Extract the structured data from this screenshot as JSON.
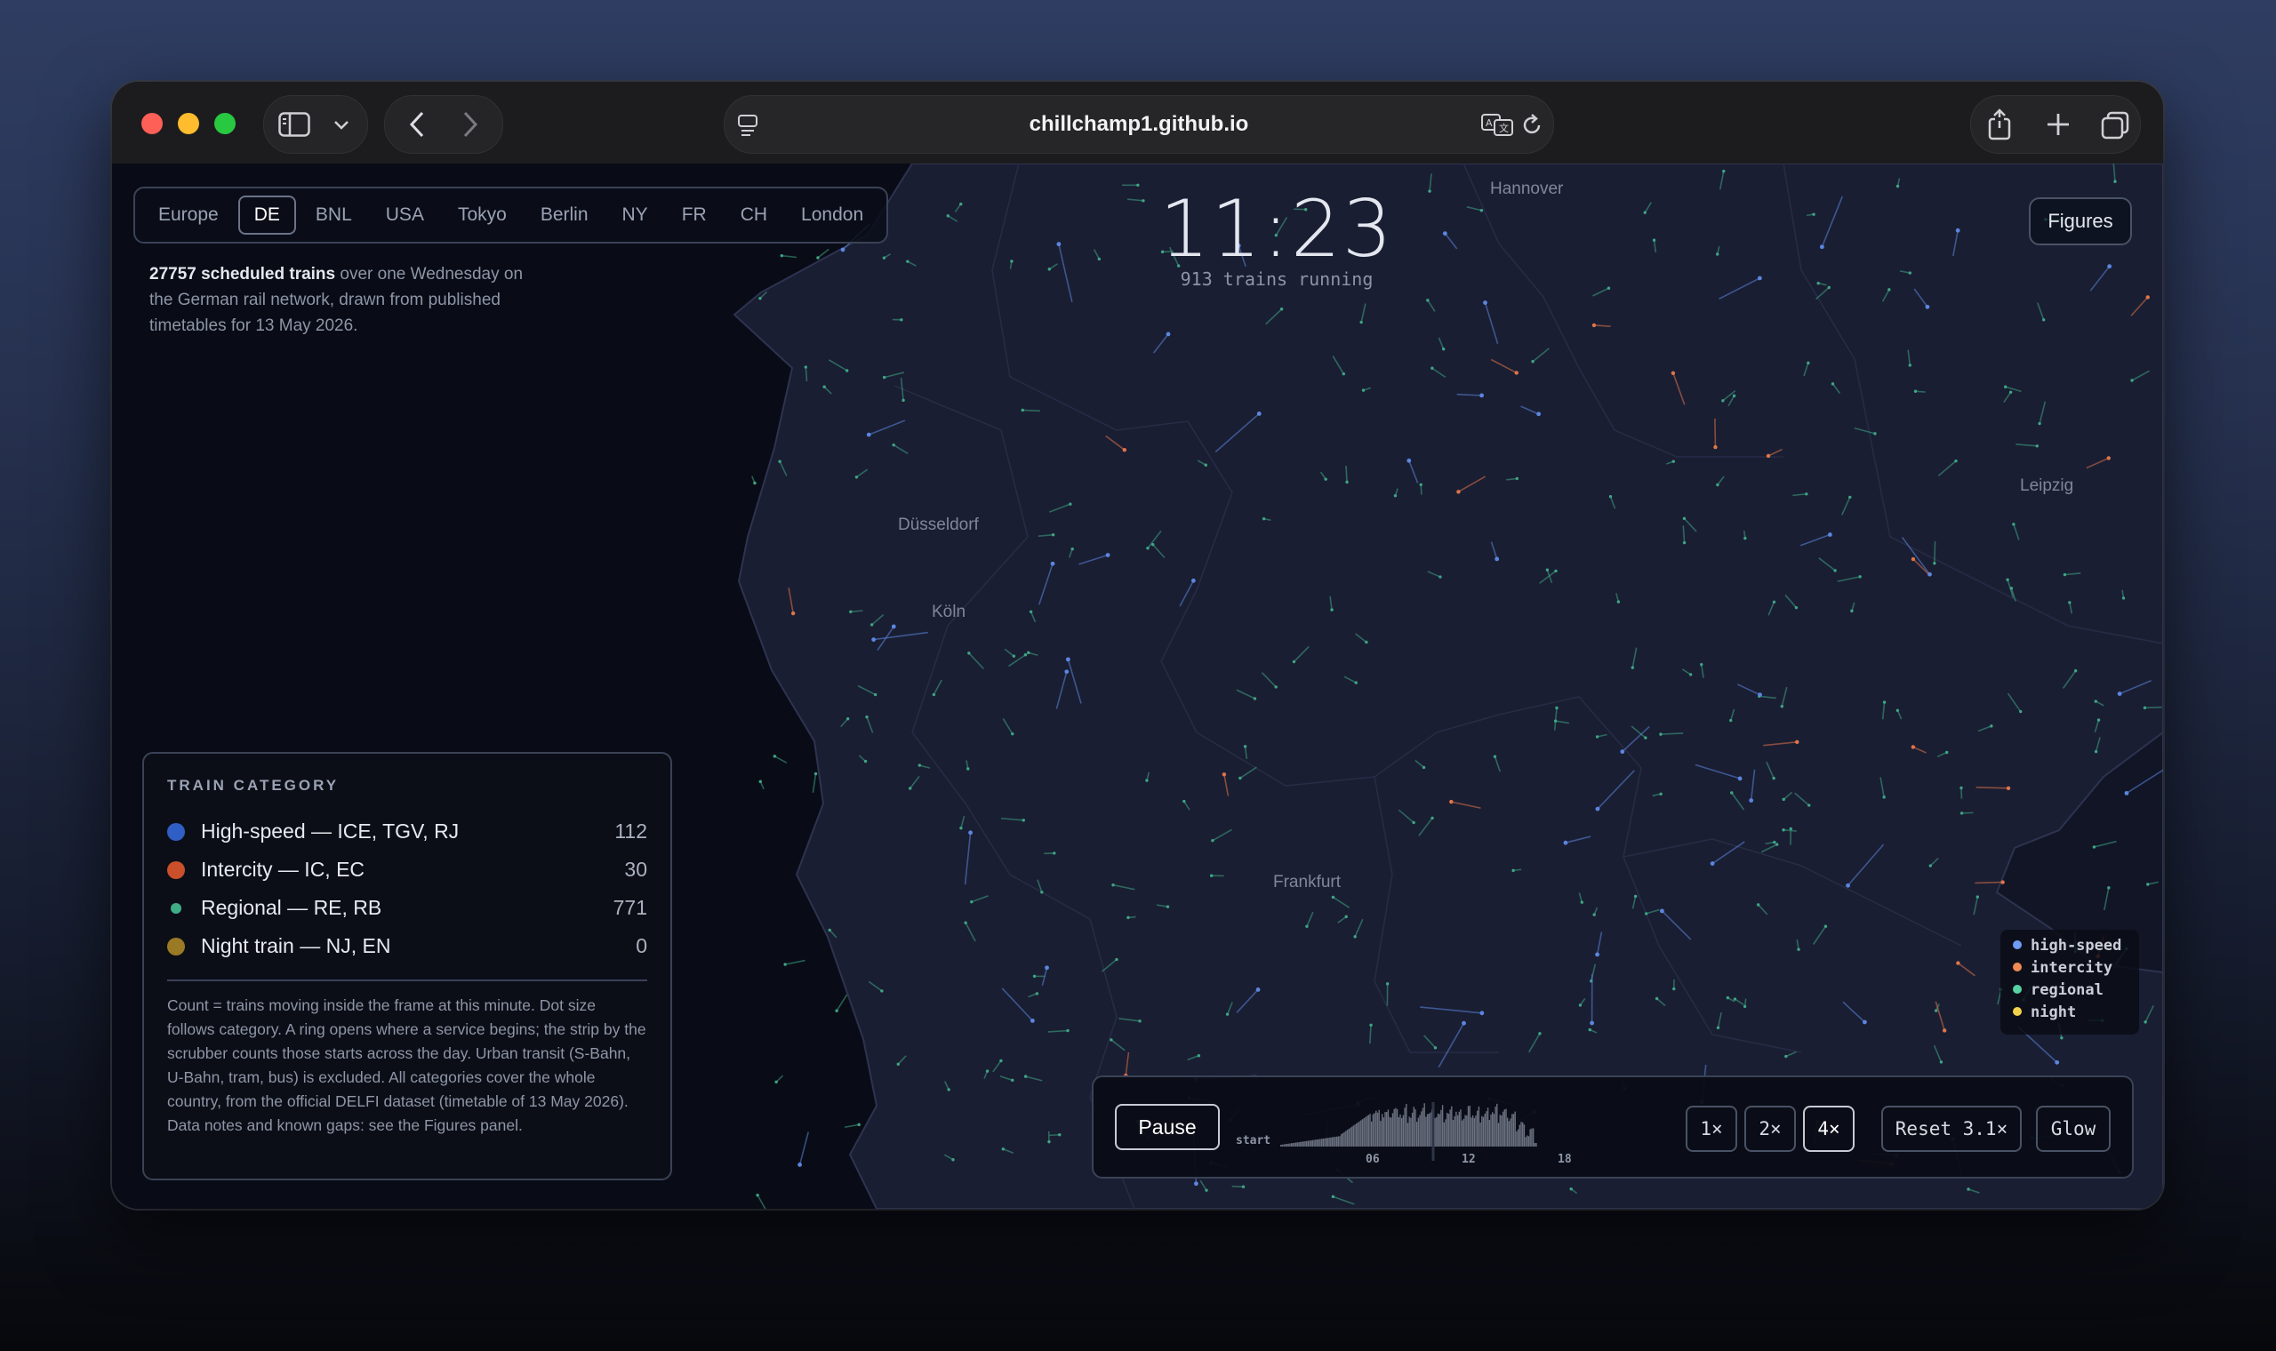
{
  "browser": {
    "url": "chillchamp1.github.io"
  },
  "tabs": [
    {
      "label": "Europe",
      "active": false
    },
    {
      "label": "DE",
      "active": true
    },
    {
      "label": "BNL",
      "active": false
    },
    {
      "label": "USA",
      "active": false
    },
    {
      "label": "Tokyo",
      "active": false
    },
    {
      "label": "Berlin",
      "active": false
    },
    {
      "label": "NY",
      "active": false
    },
    {
      "label": "FR",
      "active": false
    },
    {
      "label": "CH",
      "active": false
    },
    {
      "label": "London",
      "active": false
    }
  ],
  "intro": {
    "bold": "27757 scheduled trains",
    "rest": " over one Wednesday on the German rail network, drawn from published timetables for 13 May 2026."
  },
  "clock": {
    "time": "11:23",
    "subtitle": "913 trains running"
  },
  "figures_button": "Figures",
  "cities": [
    "Hannover",
    "Düsseldorf",
    "Köln",
    "Leipzig",
    "Frankfurt"
  ],
  "legend": {
    "title": "TRAIN CATEGORY",
    "rows": [
      {
        "label": "High-speed — ICE, TGV, RJ",
        "count": "112",
        "color": "#2f5fc4"
      },
      {
        "label": "Intercity — IC, EC",
        "count": "30",
        "color": "#c9502a"
      },
      {
        "label": "Regional — RE, RB",
        "count": "771",
        "color": "#3fae86"
      },
      {
        "label": "Night train — NJ, EN",
        "count": "0",
        "color": "#9a7a24"
      }
    ],
    "note": "Count = trains moving inside the frame at this minute. Dot size follows category. A ring opens where a service begins; the strip by the scrubber counts those starts across the day. Urban transit (S-Bahn, U-Bahn, tram, bus) is excluded. All categories cover the whole country, from the official DELFI dataset (timetable of 13 May 2026). Data notes and known gaps: see the Figures panel."
  },
  "mini_legend": [
    {
      "label": "high-speed",
      "color": "#6f9cf5"
    },
    {
      "label": "intercity",
      "color": "#f08a55"
    },
    {
      "label": "regional",
      "color": "#56d3a3"
    },
    {
      "label": "night",
      "color": "#f2d24a"
    }
  ],
  "controls": {
    "pause": "Pause",
    "timeline_start": "start",
    "timeline_ticks": [
      "06",
      "12",
      "18"
    ],
    "speeds": [
      {
        "label": "1×",
        "active": false
      },
      {
        "label": "2×",
        "active": false
      },
      {
        "label": "4×",
        "active": true
      }
    ],
    "reset": "Reset 3.1×",
    "glow": "Glow"
  }
}
